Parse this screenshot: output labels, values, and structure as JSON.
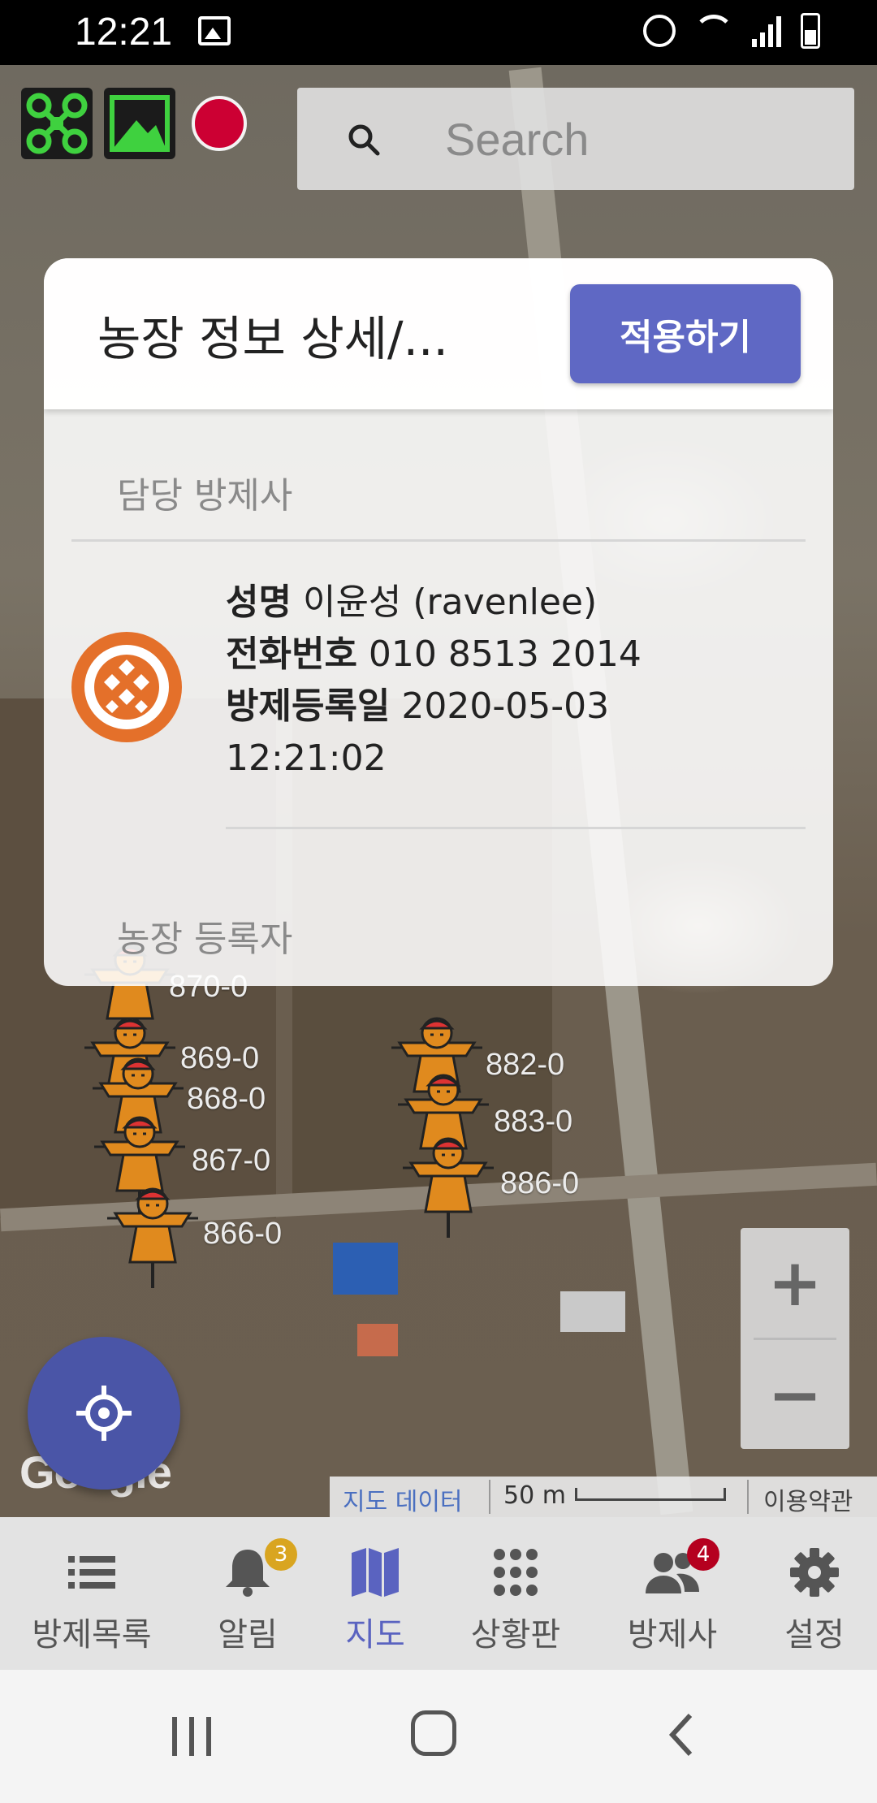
{
  "status_bar": {
    "time": "12:21"
  },
  "search": {
    "placeholder": "Search"
  },
  "card": {
    "title": "농장 정보 상세/...",
    "apply_label": "적용하기",
    "section_sprayer": "담당 방제사",
    "section_registrant": "농장 등록자",
    "name_label": "성명",
    "name_value": "이윤성 (ravenlee)",
    "phone_label": "전화번호",
    "phone_value": "010 8513 2014",
    "date_label": "방제등록일",
    "date_value": "2020-05-03",
    "time_value": "12:21:02"
  },
  "markers": [
    {
      "label": "870-0"
    },
    {
      "label": "869-0"
    },
    {
      "label": "868-0"
    },
    {
      "label": "867-0"
    },
    {
      "label": "866-0"
    },
    {
      "label": "882-0"
    },
    {
      "label": "883-0"
    },
    {
      "label": "886-0"
    }
  ],
  "map": {
    "google_logo": "Google",
    "map_data": "지도 데이터",
    "scale": "50 m",
    "terms": "이용약관",
    "zoom_in": "+",
    "zoom_out": "−"
  },
  "bottom_nav": [
    {
      "label": "방제목록",
      "icon": "list-icon"
    },
    {
      "label": "알림",
      "icon": "bell-icon",
      "badge": "3"
    },
    {
      "label": "지도",
      "icon": "map-icon",
      "active": true
    },
    {
      "label": "상황판",
      "icon": "grid-icon"
    },
    {
      "label": "방제사",
      "icon": "people-icon",
      "badge": "4"
    },
    {
      "label": "설정",
      "icon": "gear-icon"
    }
  ],
  "colors": {
    "accent": "#5f68c4",
    "record": "#cc0033",
    "badge_alert": "#b5001f",
    "badge_notice": "#d9a520",
    "marker": "#e08a1e"
  }
}
